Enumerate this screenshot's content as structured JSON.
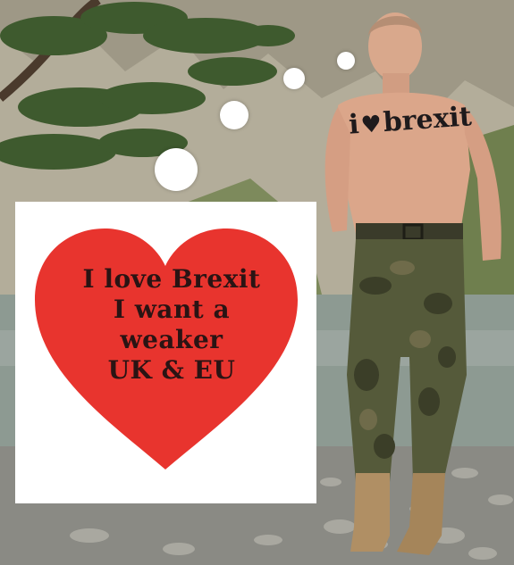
{
  "image": {
    "subject": "man-with-chest-tattoo",
    "tattoo": {
      "prefix": "i",
      "heart_glyph": "♥",
      "word": "brexit"
    },
    "heart_card": {
      "lines": [
        "I love Brexit",
        "I want a",
        "weaker",
        "UK & EU"
      ],
      "heart_color": "#e8342e",
      "card_color": "#ffffff"
    },
    "thought_bubbles_color": "#ffffff"
  }
}
